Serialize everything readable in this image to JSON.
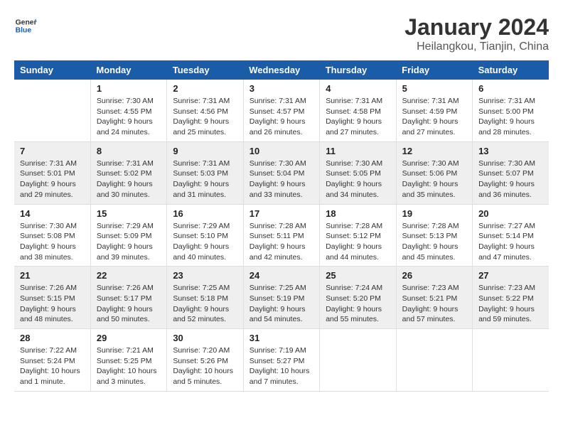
{
  "header": {
    "logo_general": "General",
    "logo_blue": "Blue",
    "month_year": "January 2024",
    "location": "Heilangkou, Tianjin, China"
  },
  "days_of_week": [
    "Sunday",
    "Monday",
    "Tuesday",
    "Wednesday",
    "Thursday",
    "Friday",
    "Saturday"
  ],
  "weeks": [
    [
      {
        "num": "",
        "sunrise": "",
        "sunset": "",
        "daylight": ""
      },
      {
        "num": "1",
        "sunrise": "Sunrise: 7:30 AM",
        "sunset": "Sunset: 4:55 PM",
        "daylight": "Daylight: 9 hours and 24 minutes."
      },
      {
        "num": "2",
        "sunrise": "Sunrise: 7:31 AM",
        "sunset": "Sunset: 4:56 PM",
        "daylight": "Daylight: 9 hours and 25 minutes."
      },
      {
        "num": "3",
        "sunrise": "Sunrise: 7:31 AM",
        "sunset": "Sunset: 4:57 PM",
        "daylight": "Daylight: 9 hours and 26 minutes."
      },
      {
        "num": "4",
        "sunrise": "Sunrise: 7:31 AM",
        "sunset": "Sunset: 4:58 PM",
        "daylight": "Daylight: 9 hours and 27 minutes."
      },
      {
        "num": "5",
        "sunrise": "Sunrise: 7:31 AM",
        "sunset": "Sunset: 4:59 PM",
        "daylight": "Daylight: 9 hours and 27 minutes."
      },
      {
        "num": "6",
        "sunrise": "Sunrise: 7:31 AM",
        "sunset": "Sunset: 5:00 PM",
        "daylight": "Daylight: 9 hours and 28 minutes."
      }
    ],
    [
      {
        "num": "7",
        "sunrise": "Sunrise: 7:31 AM",
        "sunset": "Sunset: 5:01 PM",
        "daylight": "Daylight: 9 hours and 29 minutes."
      },
      {
        "num": "8",
        "sunrise": "Sunrise: 7:31 AM",
        "sunset": "Sunset: 5:02 PM",
        "daylight": "Daylight: 9 hours and 30 minutes."
      },
      {
        "num": "9",
        "sunrise": "Sunrise: 7:31 AM",
        "sunset": "Sunset: 5:03 PM",
        "daylight": "Daylight: 9 hours and 31 minutes."
      },
      {
        "num": "10",
        "sunrise": "Sunrise: 7:30 AM",
        "sunset": "Sunset: 5:04 PM",
        "daylight": "Daylight: 9 hours and 33 minutes."
      },
      {
        "num": "11",
        "sunrise": "Sunrise: 7:30 AM",
        "sunset": "Sunset: 5:05 PM",
        "daylight": "Daylight: 9 hours and 34 minutes."
      },
      {
        "num": "12",
        "sunrise": "Sunrise: 7:30 AM",
        "sunset": "Sunset: 5:06 PM",
        "daylight": "Daylight: 9 hours and 35 minutes."
      },
      {
        "num": "13",
        "sunrise": "Sunrise: 7:30 AM",
        "sunset": "Sunset: 5:07 PM",
        "daylight": "Daylight: 9 hours and 36 minutes."
      }
    ],
    [
      {
        "num": "14",
        "sunrise": "Sunrise: 7:30 AM",
        "sunset": "Sunset: 5:08 PM",
        "daylight": "Daylight: 9 hours and 38 minutes."
      },
      {
        "num": "15",
        "sunrise": "Sunrise: 7:29 AM",
        "sunset": "Sunset: 5:09 PM",
        "daylight": "Daylight: 9 hours and 39 minutes."
      },
      {
        "num": "16",
        "sunrise": "Sunrise: 7:29 AM",
        "sunset": "Sunset: 5:10 PM",
        "daylight": "Daylight: 9 hours and 40 minutes."
      },
      {
        "num": "17",
        "sunrise": "Sunrise: 7:28 AM",
        "sunset": "Sunset: 5:11 PM",
        "daylight": "Daylight: 9 hours and 42 minutes."
      },
      {
        "num": "18",
        "sunrise": "Sunrise: 7:28 AM",
        "sunset": "Sunset: 5:12 PM",
        "daylight": "Daylight: 9 hours and 44 minutes."
      },
      {
        "num": "19",
        "sunrise": "Sunrise: 7:28 AM",
        "sunset": "Sunset: 5:13 PM",
        "daylight": "Daylight: 9 hours and 45 minutes."
      },
      {
        "num": "20",
        "sunrise": "Sunrise: 7:27 AM",
        "sunset": "Sunset: 5:14 PM",
        "daylight": "Daylight: 9 hours and 47 minutes."
      }
    ],
    [
      {
        "num": "21",
        "sunrise": "Sunrise: 7:26 AM",
        "sunset": "Sunset: 5:15 PM",
        "daylight": "Daylight: 9 hours and 48 minutes."
      },
      {
        "num": "22",
        "sunrise": "Sunrise: 7:26 AM",
        "sunset": "Sunset: 5:17 PM",
        "daylight": "Daylight: 9 hours and 50 minutes."
      },
      {
        "num": "23",
        "sunrise": "Sunrise: 7:25 AM",
        "sunset": "Sunset: 5:18 PM",
        "daylight": "Daylight: 9 hours and 52 minutes."
      },
      {
        "num": "24",
        "sunrise": "Sunrise: 7:25 AM",
        "sunset": "Sunset: 5:19 PM",
        "daylight": "Daylight: 9 hours and 54 minutes."
      },
      {
        "num": "25",
        "sunrise": "Sunrise: 7:24 AM",
        "sunset": "Sunset: 5:20 PM",
        "daylight": "Daylight: 9 hours and 55 minutes."
      },
      {
        "num": "26",
        "sunrise": "Sunrise: 7:23 AM",
        "sunset": "Sunset: 5:21 PM",
        "daylight": "Daylight: 9 hours and 57 minutes."
      },
      {
        "num": "27",
        "sunrise": "Sunrise: 7:23 AM",
        "sunset": "Sunset: 5:22 PM",
        "daylight": "Daylight: 9 hours and 59 minutes."
      }
    ],
    [
      {
        "num": "28",
        "sunrise": "Sunrise: 7:22 AM",
        "sunset": "Sunset: 5:24 PM",
        "daylight": "Daylight: 10 hours and 1 minute."
      },
      {
        "num": "29",
        "sunrise": "Sunrise: 7:21 AM",
        "sunset": "Sunset: 5:25 PM",
        "daylight": "Daylight: 10 hours and 3 minutes."
      },
      {
        "num": "30",
        "sunrise": "Sunrise: 7:20 AM",
        "sunset": "Sunset: 5:26 PM",
        "daylight": "Daylight: 10 hours and 5 minutes."
      },
      {
        "num": "31",
        "sunrise": "Sunrise: 7:19 AM",
        "sunset": "Sunset: 5:27 PM",
        "daylight": "Daylight: 10 hours and 7 minutes."
      },
      {
        "num": "",
        "sunrise": "",
        "sunset": "",
        "daylight": ""
      },
      {
        "num": "",
        "sunrise": "",
        "sunset": "",
        "daylight": ""
      },
      {
        "num": "",
        "sunrise": "",
        "sunset": "",
        "daylight": ""
      }
    ]
  ]
}
